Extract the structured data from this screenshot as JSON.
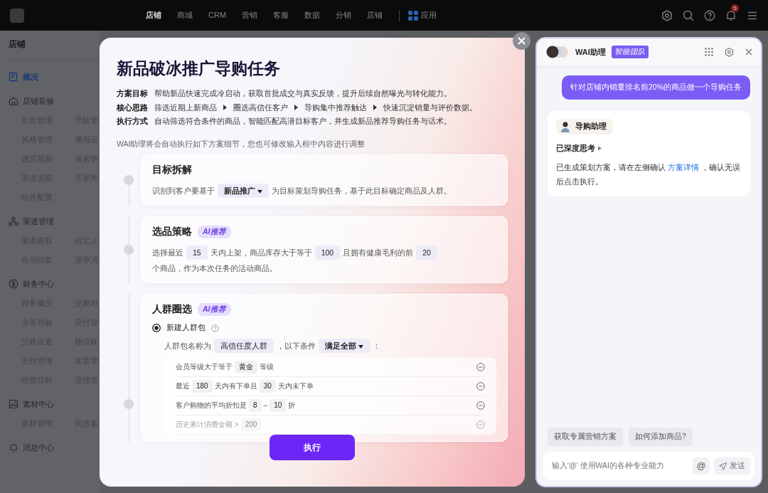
{
  "nav": {
    "items": [
      {
        "label": "店铺",
        "selected": true
      },
      {
        "label": "商城",
        "selected": false
      },
      {
        "label": "CRM",
        "selected": false
      },
      {
        "label": "营销",
        "selected": false
      },
      {
        "label": "客服",
        "selected": false
      },
      {
        "label": "数据",
        "selected": false
      },
      {
        "label": "分销",
        "selected": false
      },
      {
        "label": "店铺",
        "selected": false
      }
    ],
    "apps_label": "应用",
    "notification_count": "5"
  },
  "sidebar": {
    "title": "店铺",
    "items": [
      {
        "kind": "link",
        "label": "概况",
        "selected": true
      },
      {
        "kind": "group",
        "label": "店铺装修",
        "children": [
          {
            "label": "页面管理"
          },
          {
            "label": "导航管"
          },
          {
            "label": "风格管理"
          },
          {
            "label": "通用设"
          },
          {
            "label": "进店规则"
          },
          {
            "label": "搜索管"
          },
          {
            "label": "渠道追踪"
          },
          {
            "label": "开屏推"
          },
          {
            "label": "组件配置"
          }
        ]
      },
      {
        "kind": "group",
        "label": "渠道管理",
        "children": [
          {
            "label": "渠道授权"
          },
          {
            "label": "自定义"
          },
          {
            "label": "自动回复"
          },
          {
            "label": "菜单消"
          }
        ]
      },
      {
        "kind": "group",
        "label": "财务中心",
        "children": [
          {
            "label": "财务概况"
          },
          {
            "label": "交易对"
          },
          {
            "label": "业务对账"
          },
          {
            "label": "应付管"
          },
          {
            "label": "分账设置"
          },
          {
            "label": "物流账"
          },
          {
            "label": "支付管理"
          },
          {
            "label": "发票管"
          },
          {
            "label": "经营目标"
          },
          {
            "label": "业绩管"
          }
        ]
      },
      {
        "kind": "group",
        "label": "素材中心",
        "children": [
          {
            "label": "素材管理"
          },
          {
            "label": "同步素"
          }
        ]
      },
      {
        "kind": "group",
        "label": "消息中心"
      }
    ]
  },
  "modal": {
    "title": "新品破冰推广导购任务",
    "info": [
      {
        "label": "方案目标",
        "text": "帮助新品快速完成冷启动，获取首批成交与真实反馈，提升后续自然曝光与转化能力。"
      },
      {
        "label": "核心思路",
        "steps": [
          "筛选近期上新商品",
          "圈选高信任客户",
          "导购集中推荐触达",
          "快速沉淀销量与评价数据。"
        ]
      },
      {
        "label": "执行方式",
        "text": "自动筛选符合条件的商品，智能匹配高潜目标客户，并生成新品推荐导购任务与话术。"
      }
    ],
    "note": "WAI助理将会自动执行如下方案细节，您也可修改输入框中内容进行调整",
    "sections": [
      {
        "title": "目标拆解",
        "parts": [
          {
            "kind": "text",
            "text": "识别到客户要基于"
          },
          {
            "kind": "dropdown",
            "value": "新品推广"
          },
          {
            "kind": "text",
            "text": "为目标策划导购任务，基于此目标确定商品及人群。"
          }
        ]
      },
      {
        "title": "选品策略",
        "badge": "AI推荐",
        "parts": [
          {
            "kind": "text",
            "text": "选择最近"
          },
          {
            "kind": "value",
            "value": "15"
          },
          {
            "kind": "text",
            "text": "天内上架，商品库存大于等于"
          },
          {
            "kind": "value",
            "value": "100"
          },
          {
            "kind": "text",
            "text": "且拥有健康毛利的前"
          },
          {
            "kind": "value",
            "value": "20"
          },
          {
            "kind": "text",
            "text": "个商品，作为本次"
          },
          {
            "kind": "text",
            "text": "任务的活动商品。"
          }
        ]
      },
      {
        "title": "人群圈选",
        "badge": "AI推荐",
        "option": {
          "label": "新建人群包",
          "selected": true
        },
        "parts": [
          {
            "kind": "text",
            "text": "人群包名称为"
          },
          {
            "kind": "value",
            "value": "高信任度人群"
          },
          {
            "kind": "text",
            "text": "，以下条件"
          },
          {
            "kind": "dropdown",
            "value": "满足全部"
          },
          {
            "kind": "text",
            "text": "："
          }
        ],
        "conditions": [
          {
            "muted": false,
            "parts": [
              {
                "kind": "text",
                "text": "会员等级大于等于"
              },
              {
                "kind": "value",
                "value": "黄金"
              },
              {
                "kind": "text",
                "text": "等级"
              }
            ]
          },
          {
            "muted": false,
            "parts": [
              {
                "kind": "text",
                "text": "最近"
              },
              {
                "kind": "value",
                "value": "180"
              },
              {
                "kind": "text",
                "text": "天内有下单且"
              },
              {
                "kind": "value",
                "value": "30"
              },
              {
                "kind": "text",
                "text": "天内未下单"
              }
            ]
          },
          {
            "muted": false,
            "parts": [
              {
                "kind": "text",
                "text": "客户购物的平均折扣是"
              },
              {
                "kind": "value",
                "value": "8"
              },
              {
                "kind": "text",
                "text": "–"
              },
              {
                "kind": "value",
                "value": "10"
              },
              {
                "kind": "text",
                "text": "折"
              }
            ]
          },
          {
            "muted": true,
            "parts": [
              {
                "kind": "text",
                "text": "历史累计消费金额 >"
              },
              {
                "kind": "value",
                "value": "200"
              }
            ]
          }
        ]
      }
    ],
    "execute_label": "执行"
  },
  "chat": {
    "title": "WAI助理",
    "badge": "智能团队",
    "messages": [
      {
        "kind": "user",
        "text": "针对店铺内销量排名前20%的商品做一个导购任务"
      },
      {
        "kind": "bot",
        "agent": "导购助理",
        "thinking": "已深度思考",
        "thinking_expanded": false,
        "before": "已生成策划方案，请在左侧确认 ",
        "link": "方案详情",
        "after": " ，确认无误后点击执行。"
      }
    ],
    "suggestions": [
      "获取专属营销方案",
      "如何添加商品?"
    ],
    "input": {
      "placeholder": "输入'@' 使用WAI的各种专业能力"
    },
    "at_label": "@",
    "send_label": "发送"
  }
}
